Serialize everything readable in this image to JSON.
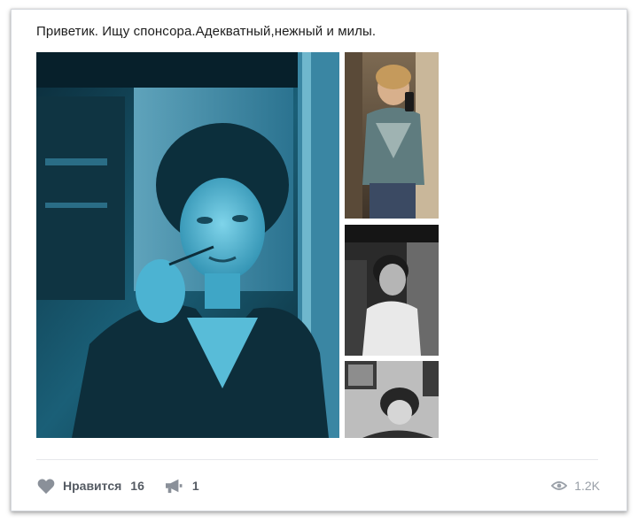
{
  "post": {
    "text": "Приветик. Ищу спонсора.Адекватный,нежный и милы."
  },
  "photos": [
    {
      "kind": "main-photo",
      "tone": "cyan"
    },
    {
      "kind": "thumbnail",
      "tone": "color"
    },
    {
      "kind": "thumbnail",
      "tone": "grayscale"
    },
    {
      "kind": "thumbnail",
      "tone": "grayscale"
    }
  ],
  "actions": {
    "like_label": "Нравится",
    "like_count": "16",
    "like_icon": "heart-icon",
    "share_count": "1",
    "share_icon": "megaphone-icon",
    "views_count": "1.2K",
    "views_icon": "eye-icon"
  },
  "colors": {
    "action_icon": "#8a9099",
    "views_text": "#9aa0a8"
  }
}
